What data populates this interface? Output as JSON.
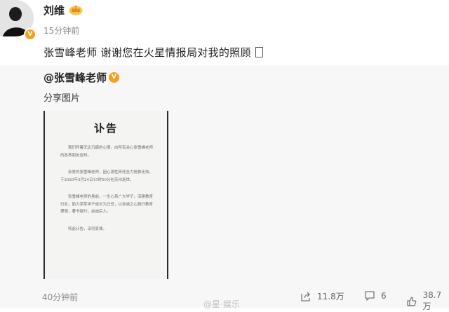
{
  "post": {
    "username": "刘维",
    "time_ago": "15分钟前",
    "text": "张雪峰老师 谢谢您在火星情报局对我的照顾",
    "emoji_icon": "unsupported-emoji-box-icon",
    "accent_color": "#f0a21b"
  },
  "repost": {
    "username": "@张雪峰老师",
    "text": "分享图片",
    "image": {
      "title": "讣告",
      "paragraphs": [
        "我们怀着无比沉痛的心情，向所有关心张雪峰老师的各界朋友告知。",
        "亲爱的张雪峰老师，因心源性猝死全力抢救无效，于2020年3月24日15时50分在苏州逝世。",
        "张雪峰老师的身前，一生心系广大学子，深耕教育行业，助力莘莘学子成长为己任，以赤诚之心践行教育理想，著书授行，启迪后人。",
        "特此讣告，深切哀悼。"
      ]
    }
  },
  "footer": {
    "time": "40分钟前",
    "share_count": "11.8万",
    "comment_count": "6",
    "like_count": "38.7万",
    "watermark": "@星·娱乐"
  }
}
